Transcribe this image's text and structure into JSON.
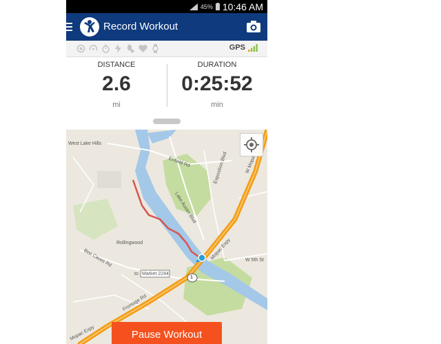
{
  "status_bar": {
    "battery_percent": "45%",
    "time": "10:46 AM"
  },
  "app_bar": {
    "title": "Record Workout",
    "menu_icon": "hamburger-menu-icon",
    "camera_icon": "camera-icon",
    "background_color": "#0f3a7d"
  },
  "sensor_bar": {
    "icons": [
      "heart-sensor-icon",
      "cadence-icon",
      "stopwatch-icon",
      "power-icon",
      "foot-pod-icon",
      "heart-icon",
      "watch-icon"
    ],
    "gps_label": "GPS",
    "gps_signal_bars": 4
  },
  "stats": {
    "distance": {
      "label": "DISTANCE",
      "value": "2.6",
      "unit": "mi"
    },
    "duration": {
      "label": "DURATION",
      "value": "0:25:52",
      "unit": "min"
    }
  },
  "map": {
    "labels": {
      "west_lake_hills": "West Lake Hills",
      "enfield_rd": "Enfield Rd",
      "exposition_blvd": "Exposition Blvd",
      "lake_austin_blvd": "Lake Austin Blvd",
      "mopac_expy": "Mopac Expy",
      "mopac_expy_lower": "Mopac Expy",
      "w_mopac_expy": "W Mopac Expy",
      "rollingwood": "Rollingwood",
      "bee_caves_rd": "Bee Caves Rd",
      "market_2244": "Market 2244",
      "market_prefix": "to",
      "frontage_rd": "Frontage Rd",
      "w_5th_st": "W 5th St",
      "route_shield": "1"
    },
    "route_color": "#d9534f",
    "highway_color": "#f39c12",
    "water_color": "#a4c8e8",
    "park_color": "#c5dca0",
    "locate_icon": "locate-crosshair-icon"
  },
  "action": {
    "pause_label": "Pause Workout",
    "color": "#f4511e"
  }
}
